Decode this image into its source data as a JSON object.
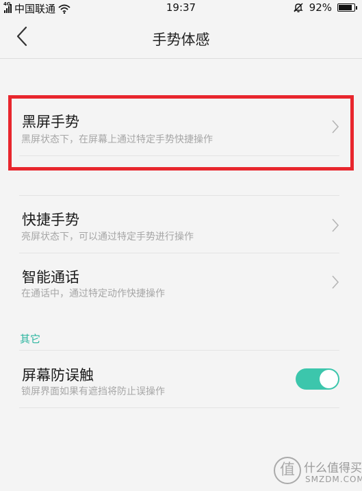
{
  "status_bar": {
    "carrier": "中国联通",
    "time": "19:37",
    "battery": "92%",
    "battery_level": 0.92,
    "icons": [
      "signal-icon",
      "wifi-icon",
      "mute-bell-icon",
      "battery-icon"
    ]
  },
  "header": {
    "title": "手势体感",
    "back_icon": "back-chevron-icon"
  },
  "items": [
    {
      "title": "黑屏手势",
      "subtitle": "黑屏状态下，在屏幕上通过特定手势快捷操作",
      "icon": "chevron-right-icon",
      "highlighted": true
    },
    {
      "title": "快捷手势",
      "subtitle": "亮屏状态下，可以通过特定手势进行操作",
      "icon": "chevron-right-icon"
    },
    {
      "title": "智能通话",
      "subtitle": "在通话中，通过特定动作快捷操作",
      "icon": "chevron-right-icon"
    }
  ],
  "other_section": {
    "header": "其它",
    "toggle_item": {
      "title": "屏幕防误触",
      "subtitle": "锁屏界面如果有遮挡将防止误操作",
      "enabled": true
    }
  },
  "watermark": {
    "logo_glyph": "值",
    "text": "什么值得买",
    "sub": "SMZDM.COM"
  },
  "colors": {
    "accent": "#2bb59f",
    "toggle_on": "#3cc6ac",
    "highlight": "#e8262d",
    "background": "#f4f4f4"
  }
}
